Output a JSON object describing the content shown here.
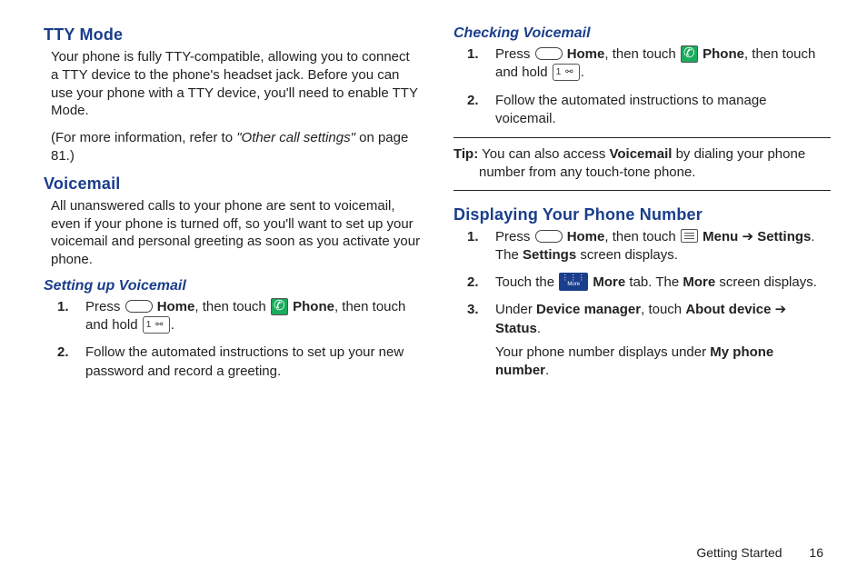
{
  "left": {
    "tty_heading": "TTY Mode",
    "tty_p1": "Your phone is fully TTY-compatible, allowing you to connect a TTY device to the phone's headset jack. Before you can use your phone with a TTY device, you'll need to enable TTY Mode.",
    "tty_p2_a": "(For more information, refer to ",
    "tty_p2_i": "\"Other call settings\"",
    "tty_p2_b": " on page 81.)",
    "vm_heading": "Voicemail",
    "vm_p1": "All unanswered calls to your phone are sent to voicemail, even if your phone is turned off, so you'll want to set up your voicemail and personal greeting as soon as you activate your phone.",
    "vm_sub1": "Setting up Voicemail",
    "step1_a": "Press ",
    "home_label": "Home",
    "step1_b": ", then touch ",
    "phone_label": "Phone",
    "step1_c": ", then touch and hold ",
    "period": ".",
    "step2": "Follow the automated instructions to set up your new password and record a greeting."
  },
  "right": {
    "check_heading": "Checking Voicemail",
    "cstep1_a": "Press ",
    "cstep1_b": ", then touch ",
    "cstep1_c": ", then touch and hold ",
    "cstep2": "Follow the automated instructions to manage voicemail.",
    "tip_label": "Tip:",
    "tip_a": " You can also access ",
    "tip_bold": "Voicemail",
    "tip_b": " by dialing your phone number from any touch-tone phone.",
    "disp_heading": "Displaying Your Phone Number",
    "d1_a": "Press ",
    "d1_b": ", then touch ",
    "menu_label": "Menu",
    "arrow": " ➔ ",
    "settings_label": "Settings",
    "d1_c": ". The ",
    "settings2": "Settings",
    "d1_d": " screen displays.",
    "d2_a": "Touch the ",
    "more_label": "More",
    "d2_b": " tab. The ",
    "d2_c": " screen displays.",
    "d3_a": "Under ",
    "devmgr": "Device manager",
    "d3_b": ", touch ",
    "about": "About device",
    "status": "Status",
    "d3_c": ".",
    "d3_p2a": "Your phone number displays under ",
    "myphone": "My phone number",
    "d3_p2b": "."
  },
  "footer": {
    "section": "Getting Started",
    "page": "16"
  }
}
